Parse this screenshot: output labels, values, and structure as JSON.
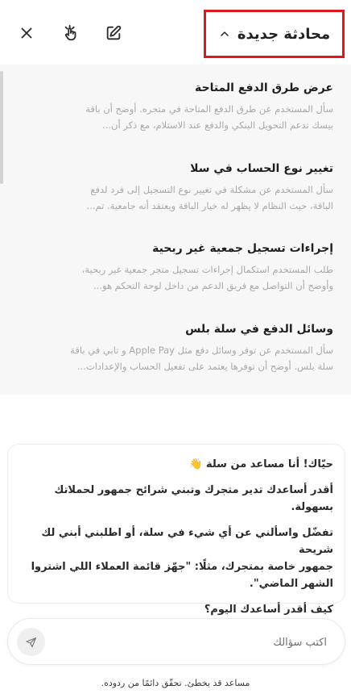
{
  "header": {
    "title": "محادثة جديدة",
    "icons": {
      "close": "close-icon",
      "gesture": "hand-gesture-icon",
      "new_chat": "edit-icon",
      "toggle": "chevron-up-icon"
    }
  },
  "history": {
    "conversations": [
      {
        "title": "عرض طرق الدفع المتاحة",
        "summary_line1": "سأل المستخدم عن طرق الدفع المتاحة في متجره. أوضح أن باقة",
        "summary_line2": "بيسك تدعم التحويل البنكي والدفع عند الاستلام، مع ذكر أن..."
      },
      {
        "title": "تغيير نوع الحساب في سلا",
        "summary_line1": "سأل المستخدم عن مشكلة في تغيير نوع التسجيل إلى فرد لدفع",
        "summary_line2": "الباقة، حيث النظام لا يظهر له خيار الباقة ويعتقد أنه جامعية. تم..."
      },
      {
        "title": "إجراءات تسجيل جمعية غير ربحية",
        "summary_line1": "طلب المستخدم استكمال إجراءات تسجيل متجر جمعية غير ربحية،",
        "summary_line2": "وأوضح أن التواصل مع فريق الدعم من داخل لوحة التحكم هو..."
      },
      {
        "title": "وسائل الدفع في سلة بلس",
        "summary_line1": "سأل المستخدم عن توفر وسائل دفع مثل Apple Pay و تابي في باقة",
        "summary_line2": "سلة بلس. أوضح أن توفرها يعتمد على تفعيل الحساب والإعدادات..."
      }
    ]
  },
  "welcome": {
    "greeting": "حيّاك! أنا مساعد من سلة 👋",
    "paragraph2": "أقدر أساعدك تدير متجرك وتبني شرائح جمهور لحملاتك بسهولة.",
    "paragraph3_line1": "تفضّل واسألني عن أي شيء في سلة، أو اطلبني أبني لك شريحة",
    "paragraph3_line2": "جمهور خاصة بمتجرك، مثلًا: \"جهّز قائمة العملاء اللي اشتروا",
    "paragraph3_line3": "الشهر الماضي\".",
    "question": "كيف أقدر أساعدك اليوم؟"
  },
  "composer": {
    "placeholder": "اكتب سؤالك",
    "value": "",
    "send_icon": "send-icon"
  },
  "footer": {
    "disclaimer": "مساعد قد يخطئ. تحقّق دائمًا من ردوده."
  }
}
